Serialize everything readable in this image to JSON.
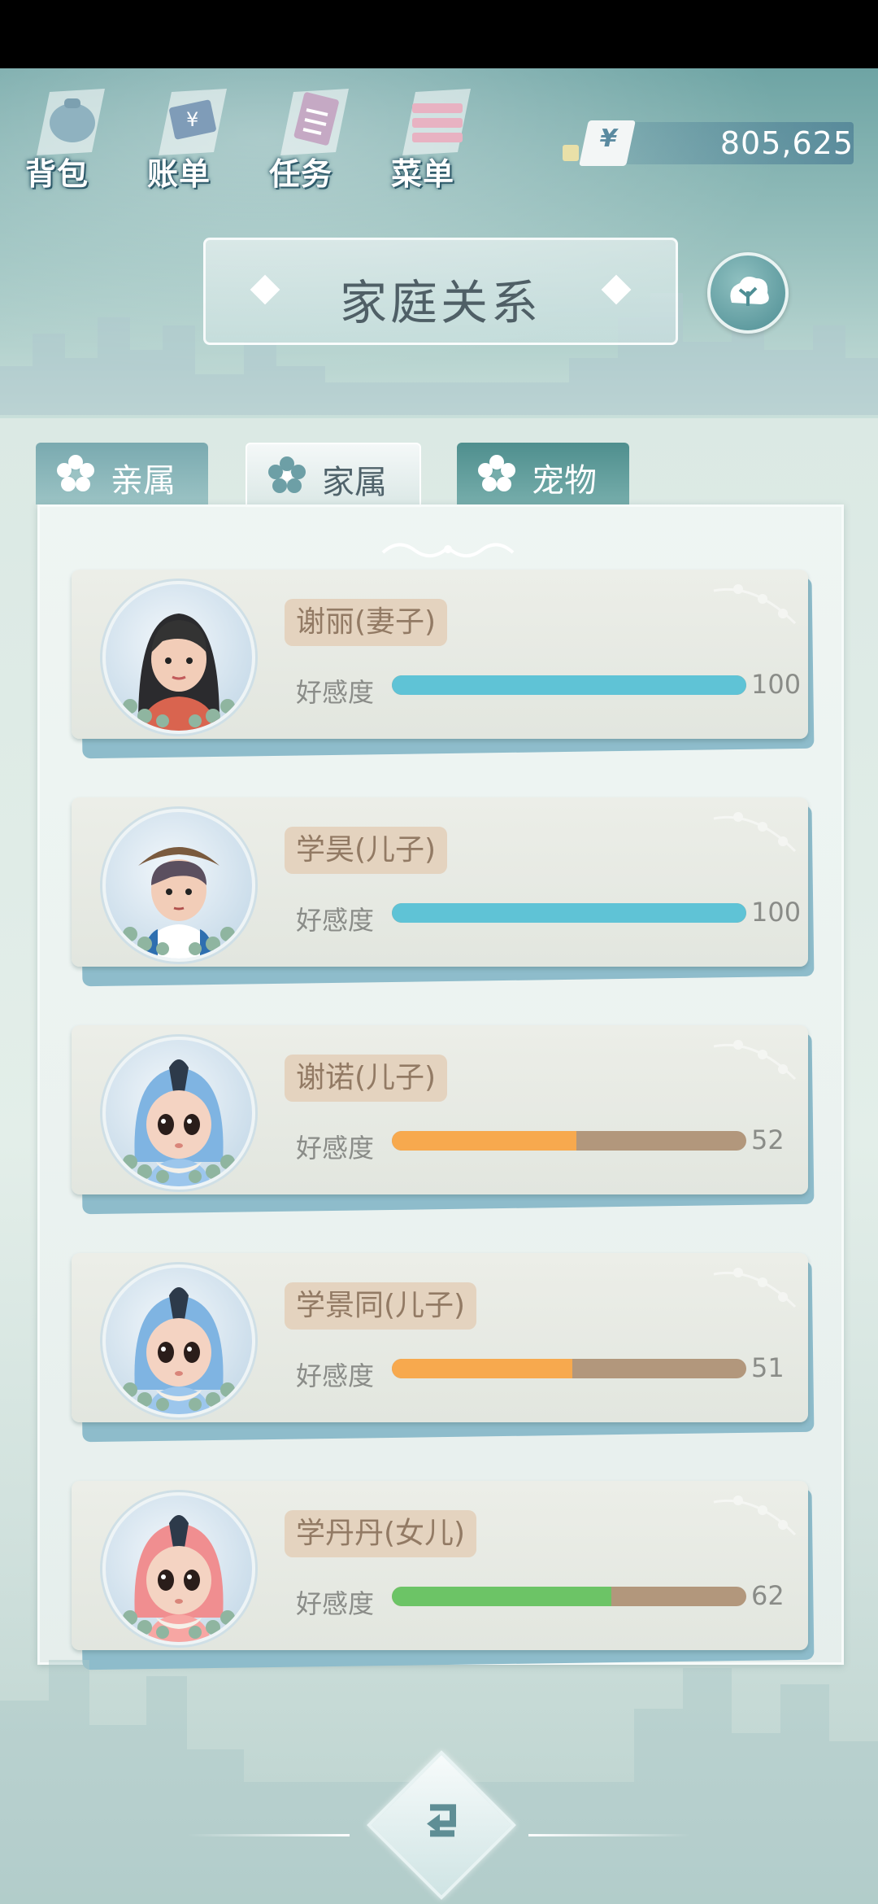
{
  "topnav": [
    {
      "label": "背包",
      "icon": "bag-icon"
    },
    {
      "label": "账单",
      "icon": "bill-icon"
    },
    {
      "label": "任务",
      "icon": "task-icon"
    },
    {
      "label": "菜单",
      "icon": "menu-icon"
    }
  ],
  "currency": {
    "symbol": "¥",
    "amount": "805,625"
  },
  "page_title": "家庭关系",
  "tabs": [
    {
      "label": "亲属"
    },
    {
      "label": "家属"
    },
    {
      "label": "宠物"
    }
  ],
  "affinity_label": "好感度",
  "members": [
    {
      "name": "谢丽(妻子)",
      "affinity": 100,
      "bar_color": "#5fc3d6",
      "avatar": "woman"
    },
    {
      "name": "学昊(儿子)",
      "affinity": 100,
      "bar_color": "#5fc3d6",
      "avatar": "boy"
    },
    {
      "name": "谢诺(儿子)",
      "affinity": 52,
      "bar_color": "#f7a94e",
      "avatar": "baby-blue"
    },
    {
      "name": "学景同(儿子)",
      "affinity": 51,
      "bar_color": "#f7a94e",
      "avatar": "baby-blue"
    },
    {
      "name": "学丹丹(女儿)",
      "affinity": 62,
      "bar_color": "#6cc466",
      "avatar": "baby-pink"
    }
  ],
  "colors": {
    "accent": "#5f9ea0",
    "tag_bg": "#e4d3bf",
    "bar_track": "#b2977c"
  }
}
